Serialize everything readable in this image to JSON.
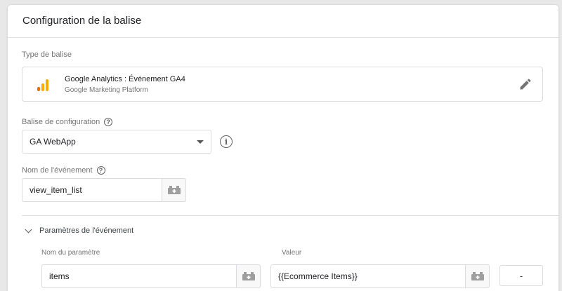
{
  "card": {
    "title": "Configuration de la balise"
  },
  "tag_type": {
    "label": "Type de balise",
    "name": "Google Analytics : Événement GA4",
    "provider": "Google Marketing Platform",
    "logo_colors": [
      "#f9ab00",
      "#e37400",
      "#e37400"
    ]
  },
  "config_tag": {
    "label": "Balise de configuration",
    "value": "GA WebApp"
  },
  "event_name": {
    "label": "Nom de l'événement",
    "value": "view_item_list"
  },
  "event_params": {
    "title": "Paramètres de l'événement",
    "col_name": "Nom du paramètre",
    "col_value": "Valeur",
    "rows": [
      {
        "name": "items",
        "value": "{{Ecommerce Items}}"
      }
    ],
    "remove_label": "-"
  },
  "icons": {
    "edit": "pencil-icon",
    "help": "help-circle-icon",
    "info": "info-icon",
    "variable": "variable-picker-icon",
    "expand": "chevron-down-icon"
  }
}
